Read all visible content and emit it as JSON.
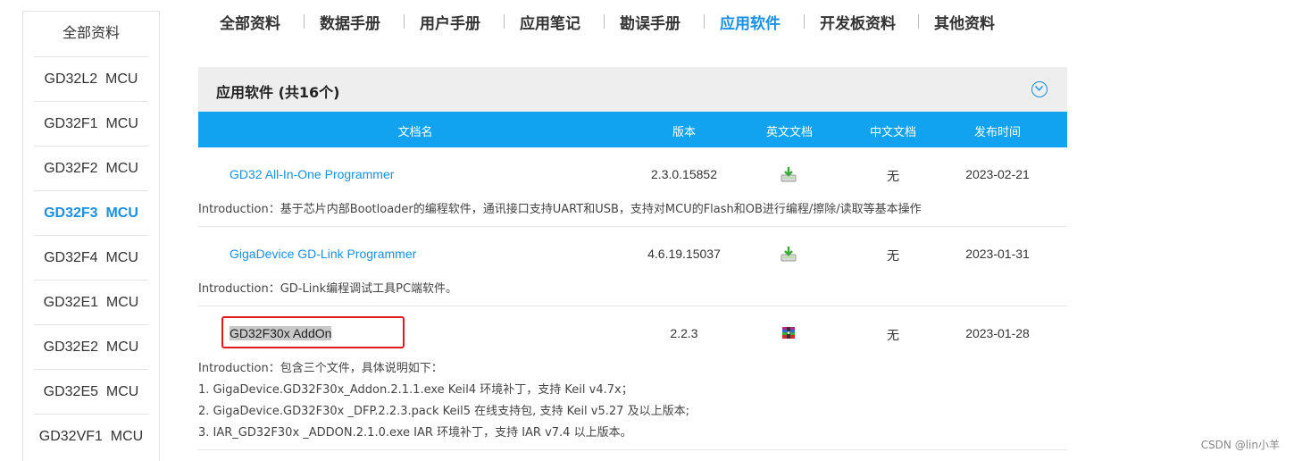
{
  "sidebar": {
    "items": [
      {
        "label": "全部资料",
        "active": false
      },
      {
        "label": "GD32L2  MCU",
        "active": false
      },
      {
        "label": "GD32F1  MCU",
        "active": false
      },
      {
        "label": "GD32F2  MCU",
        "active": false
      },
      {
        "label": "GD32F3  MCU",
        "active": true
      },
      {
        "label": "GD32F4  MCU",
        "active": false
      },
      {
        "label": "GD32E1  MCU",
        "active": false
      },
      {
        "label": "GD32E2  MCU",
        "active": false
      },
      {
        "label": "GD32E5  MCU",
        "active": false
      },
      {
        "label": "GD32VF1  MCU",
        "active": false
      }
    ]
  },
  "tabs": [
    {
      "label": "全部资料"
    },
    {
      "label": "数据手册"
    },
    {
      "label": "用户手册"
    },
    {
      "label": "应用笔记"
    },
    {
      "label": "勘误手册"
    },
    {
      "label": "应用软件",
      "active": true
    },
    {
      "label": "开发板资料"
    },
    {
      "label": "其他资料"
    }
  ],
  "panel": {
    "title": "应用软件 (共16个)",
    "columns": {
      "name": "文档名",
      "version": "版本",
      "english": "英文文档",
      "chinese": "中文文档",
      "date": "发布时间"
    },
    "rows": [
      {
        "name": "GD32 All-In-One Programmer",
        "version": "2.3.0.15852",
        "english_icon": "download-icon",
        "chinese": "无",
        "date": "2023-02-21",
        "intro": [
          "Introduction：基于芯片内部Bootloader的编程软件，通讯接口支持UART和USB，支持对MCU的Flash和OB进行编程/擦除/读取等基本操作"
        ]
      },
      {
        "name": "GigaDevice GD-Link Programmer",
        "version": "4.6.19.15037",
        "english_icon": "download-icon",
        "chinese": "无",
        "date": "2023-01-31",
        "intro": [
          "Introduction：GD-Link编程调试工具PC端软件。"
        ]
      },
      {
        "name": "GD32F30x AddOn",
        "version": "2.2.3",
        "english_icon": "archive-icon",
        "chinese": "无",
        "date": "2023-01-28",
        "intro": [
          "Introduction：包含三个文件，具体说明如下：",
          "1. GigaDevice.GD32F30x_Addon.2.1.1.exe Keil4 环境补丁，支持 Keil v4.7x；",
          "2. GigaDevice.GD32F30x _DFP.2.2.3.pack Keil5 在线支持包, 支持 Keil v5.27 及以上版本;",
          "3. IAR_GD32F30x _ADDON.2.1.0.exe IAR 环境补丁，支持 IAR v7.4 以上版本。"
        ]
      }
    ]
  },
  "watermark": "CSDN @lin小羊",
  "colors": {
    "accent": "#1a8fe3",
    "header_bg": "#12a3f0",
    "highlight": "#e0191b"
  }
}
